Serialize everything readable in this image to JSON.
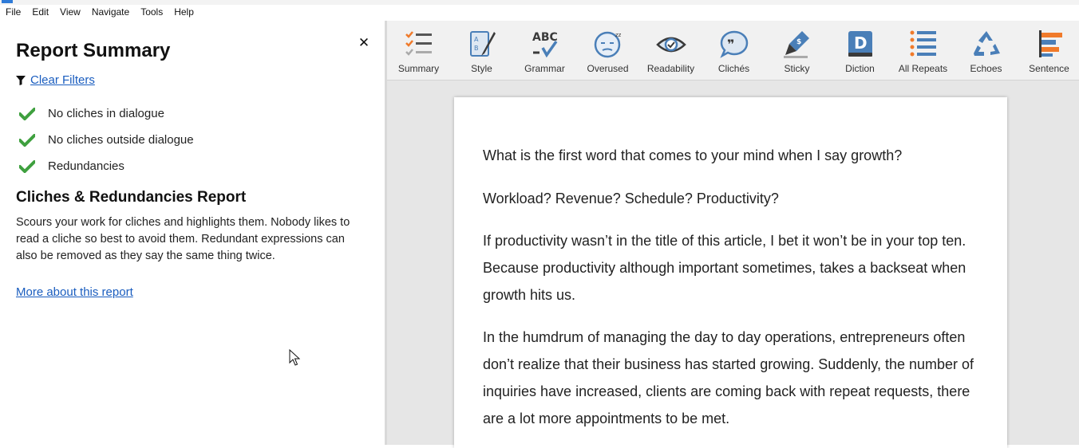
{
  "menu": {
    "items": [
      "File",
      "Edit",
      "View",
      "Navigate",
      "Tools",
      "Help"
    ]
  },
  "panel": {
    "title": "Report Summary",
    "clear_filters": "Clear Filters",
    "checks": [
      "No cliches in dialogue",
      "No cliches outside dialogue",
      "Redundancies"
    ],
    "report_title": "Cliches & Redundancies Report",
    "report_desc": "Scours your work for cliches and highlights them. Nobody likes to read a cliche so best to avoid them. Redundant expressions can also be removed as they say the same thing twice.",
    "more_link": "More about this report"
  },
  "toolbar": {
    "tools": [
      {
        "label": "Summary",
        "icon": "summary-icon"
      },
      {
        "label": "Style",
        "icon": "style-icon"
      },
      {
        "label": "Grammar",
        "icon": "grammar-icon",
        "glyph_top": "ABC"
      },
      {
        "label": "Overused",
        "icon": "overused-icon"
      },
      {
        "label": "Readability",
        "icon": "readability-icon"
      },
      {
        "label": "Clichés",
        "icon": "cliches-icon"
      },
      {
        "label": "Sticky",
        "icon": "sticky-icon"
      },
      {
        "label": "Diction",
        "icon": "diction-icon",
        "glyph": "D"
      },
      {
        "label": "All Repeats",
        "icon": "all-repeats-icon"
      },
      {
        "label": "Echoes",
        "icon": "echoes-icon"
      },
      {
        "label": "Sentence",
        "icon": "sentence-icon"
      }
    ]
  },
  "document": {
    "paragraphs": [
      "What is the first word that comes to your mind when I say growth?",
      "Workload? Revenue? Schedule? Productivity?",
      "If productivity wasn’t in the title of this article, I bet it won’t be in your top ten. Because productivity although important sometimes, takes a backseat when growth hits us.",
      "In the humdrum of managing the day to day operations, entrepreneurs often don’t realize that their business has started growing. Suddenly, the number of inquiries have increased, clients are coming back with repeat requests, there are a lot more appointments to be met."
    ]
  },
  "colors": {
    "check": "#3fa03f",
    "link": "#1a5dbf",
    "icon_blue": "#4a7fb8",
    "icon_orange": "#f07a2a",
    "icon_dark": "#3a3a3a"
  }
}
